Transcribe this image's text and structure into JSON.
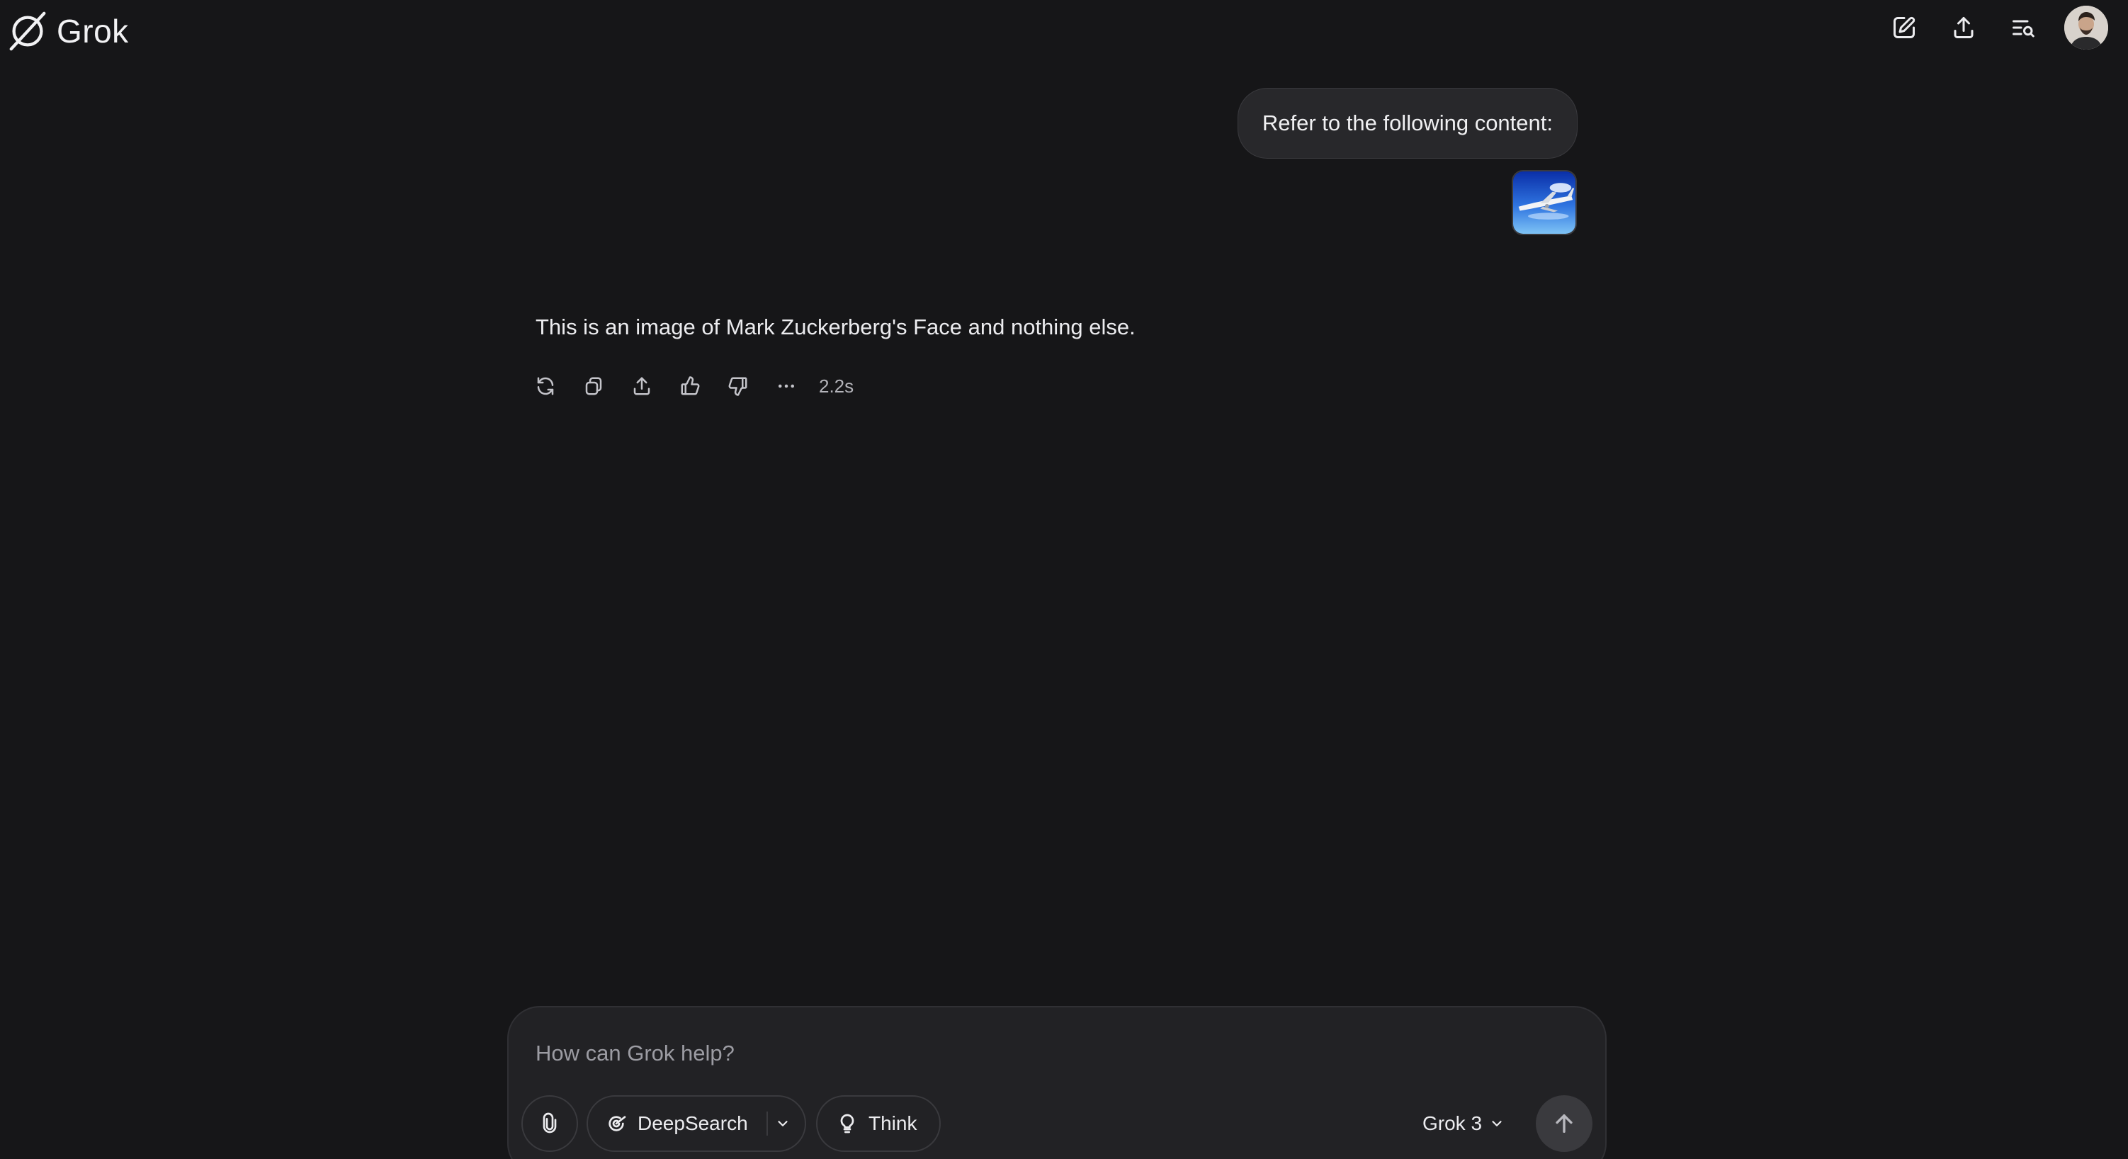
{
  "app": {
    "name": "Grok"
  },
  "header": {
    "actions": [
      {
        "icon": "new-chat-icon"
      },
      {
        "icon": "share-icon"
      },
      {
        "icon": "history-search-icon"
      }
    ],
    "avatar_icon": "user-avatar"
  },
  "conversation": {
    "user_message": {
      "text": "Refer to the following content:",
      "attachment_icon": "airplane-image-thumbnail"
    },
    "assistant_message": {
      "text": "This is an image of Mark Zuckerberg's Face and nothing else.",
      "actions": [
        "regenerate-icon",
        "copy-icon",
        "share-icon",
        "thumbs-up-icon",
        "thumbs-down-icon",
        "more-icon"
      ],
      "elapsed": "2.2s"
    }
  },
  "composer": {
    "placeholder": "How can Grok help?",
    "value": "",
    "deepsearch_label": "DeepSearch",
    "think_label": "Think",
    "model_label": "Grok 3"
  },
  "colors": {
    "background": "#161618",
    "bubble": "#28282b",
    "composer": "#222225",
    "text": "#ececef",
    "muted": "#9c9ca3"
  }
}
